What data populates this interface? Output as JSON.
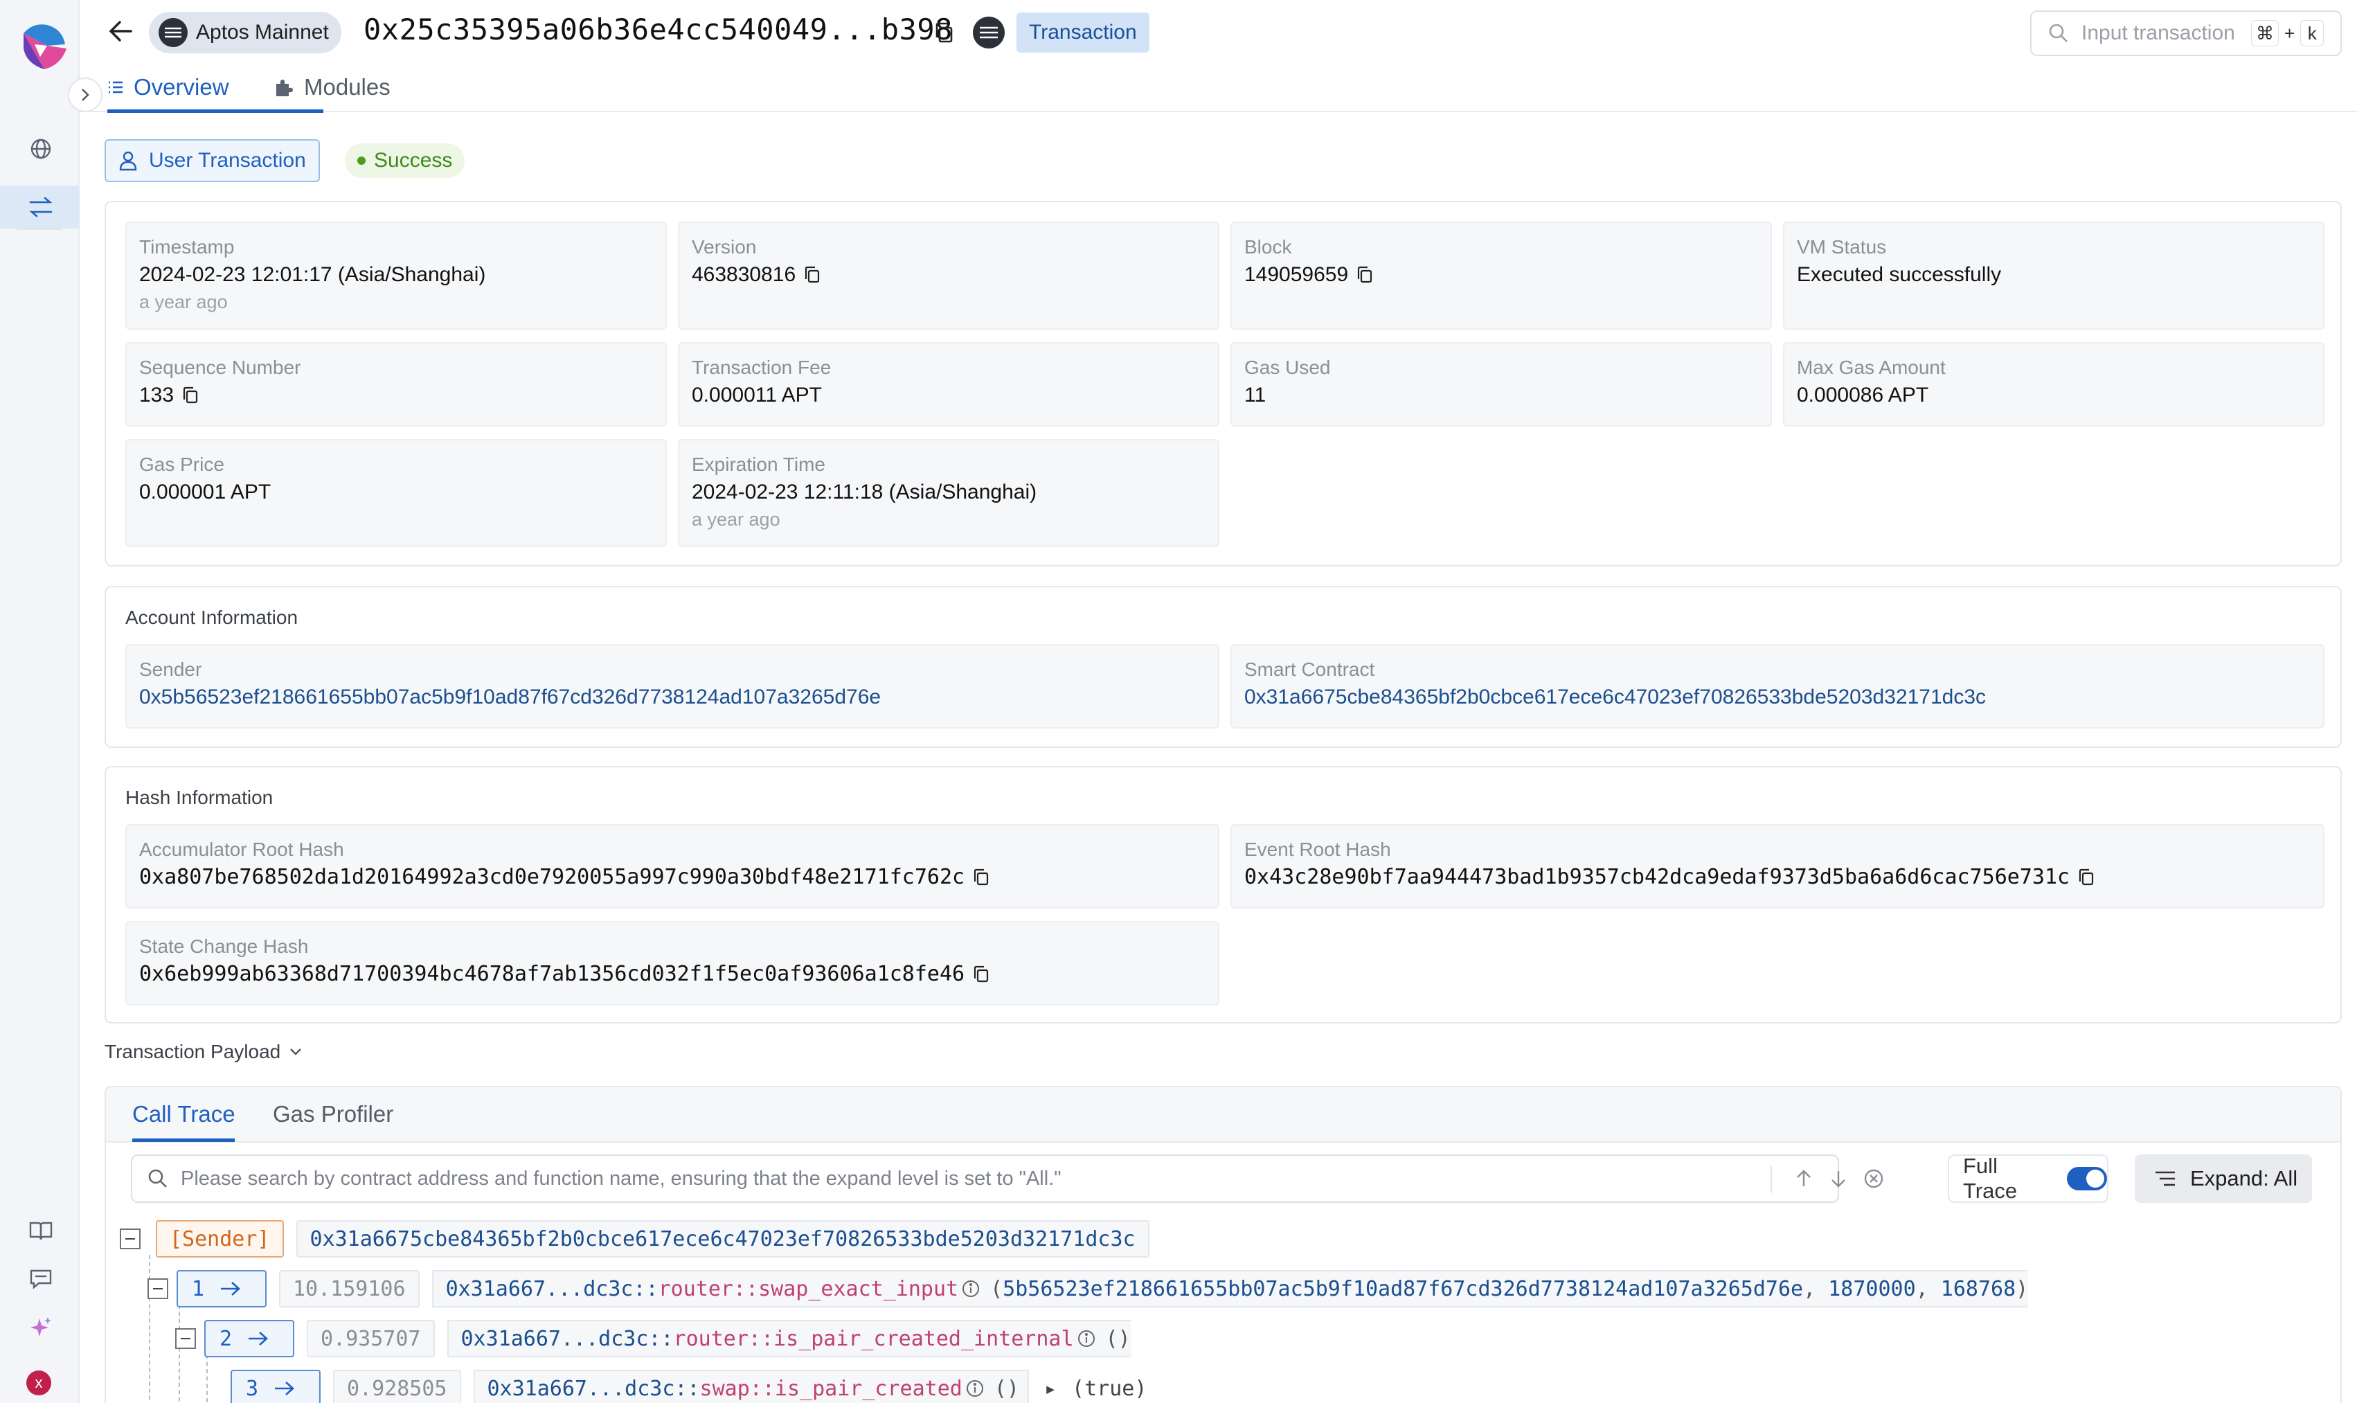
{
  "header": {
    "network": "Aptos Mainnet",
    "tx_hash": "0x25c35395a06b36e4cc540049...b398",
    "type_tag": "Transaction",
    "search_placeholder": "Input transaction",
    "kbd_cmd": "⌘",
    "kbd_plus": "+",
    "kbd_k": "k"
  },
  "tabs": {
    "overview": "Overview",
    "modules": "Modules"
  },
  "status": {
    "type": "User Transaction",
    "result": "Success"
  },
  "overview": {
    "timestamp": {
      "label": "Timestamp",
      "value": "2024-02-23 12:01:17 (Asia/Shanghai)",
      "relative": "a year ago"
    },
    "version": {
      "label": "Version",
      "value": "463830816"
    },
    "block": {
      "label": "Block",
      "value": "149059659"
    },
    "vm_status": {
      "label": "VM Status",
      "value": "Executed successfully"
    },
    "sequence_number": {
      "label": "Sequence Number",
      "value": "133"
    },
    "transaction_fee": {
      "label": "Transaction Fee",
      "value": "0.000011 APT"
    },
    "gas_used": {
      "label": "Gas Used",
      "value": "11"
    },
    "max_gas_amount": {
      "label": "Max Gas Amount",
      "value": "0.000086 APT"
    },
    "gas_price": {
      "label": "Gas Price",
      "value": "0.000001 APT"
    },
    "expiration_time": {
      "label": "Expiration Time",
      "value": "2024-02-23 12:11:18 (Asia/Shanghai)",
      "relative": "a year ago"
    }
  },
  "account": {
    "title": "Account Information",
    "sender_label": "Sender",
    "sender": "0x5b56523ef218661655bb07ac5b9f10ad87f67cd326d7738124ad107a3265d76e",
    "contract_label": "Smart Contract",
    "contract": "0x31a6675cbe84365bf2b0cbce617ece6c47023ef70826533bde5203d32171dc3c"
  },
  "hash": {
    "title": "Hash Information",
    "accumulator_label": "Accumulator Root Hash",
    "accumulator": "0xa807be768502da1d20164992a3cd0e7920055a997c990a30bdf48e2171fc762c",
    "event_label": "Event Root Hash",
    "event": "0x43c28e90bf7aa944473bad1b9357cb42dca9edaf9373d5ba6a6d6cac756e731c",
    "state_label": "State Change Hash",
    "state": "0x6eb999ab63368d71700394bc4678af7ab1356cd032f1f5ec0af93606a1c8fe46"
  },
  "payload": {
    "title": "Transaction Payload",
    "tab_call_trace": "Call Trace",
    "tab_gas_profiler": "Gas Profiler",
    "search_placeholder": "Please search by contract address and function name, ensuring that the expand level is set to \"All.\"",
    "full_trace_label": "Full Trace",
    "expand_label": "Expand: All",
    "root": {
      "tag": "[Sender]",
      "address": "0x31a6675cbe84365bf2b0cbce617ece6c47023ef70826533bde5203d32171dc3c"
    },
    "calls": [
      {
        "step": "1",
        "gas": "10.159106",
        "module": "0x31a667...dc3c::",
        "fn": "router::swap_exact_input",
        "args_open": "(",
        "arg1": "5b56523ef218661655bb07ac5b9f10ad87f67cd326d7738124ad107a3265d76e",
        "sep": ",",
        "arg2": "1870000",
        "arg3": "168768",
        "args_close": ")"
      },
      {
        "step": "2",
        "gas": "0.935707",
        "module": "0x31a667...dc3c::",
        "fn": "router::is_pair_created_internal",
        "args": "()"
      },
      {
        "step": "3",
        "gas": "0.928505",
        "module": "0x31a667...dc3c::",
        "fn": "swap::is_pair_created",
        "args": "()",
        "arrow": "▸",
        "ret": "(true)"
      }
    ]
  },
  "colors": {
    "accent": "#1f5fbf",
    "success": "#3e8a1c",
    "sender": "#d0671d",
    "function": "#c0416e"
  }
}
